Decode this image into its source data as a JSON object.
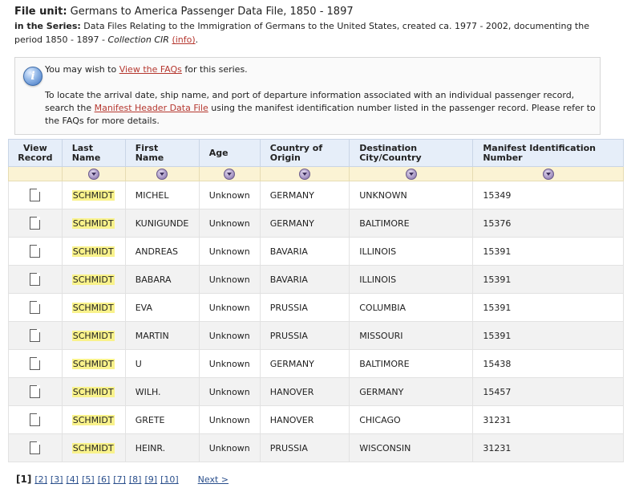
{
  "file_unit": {
    "label": "File unit:",
    "title": "Germans to America Passenger Data File, 1850 - 1897",
    "series_label": "in the Series:",
    "series_text": "Data Files Relating to the Immigration of Germans to the United States, created ca. 1977 - 2002, documenting the period 1850 - 1897 -",
    "collection": "Collection CIR",
    "info_link": "(info)",
    "period": "."
  },
  "info": {
    "icon": "info-icon",
    "line1_pre": "You may wish to ",
    "line1_link": "View the FAQs",
    "line1_post": " for this series.",
    "line2_pre": "To locate the arrival date, ship name, and port of departure information associated with an individual passenger record, search the ",
    "line2_link": "Manifest Header Data File",
    "line2_post": " using the manifest identification number listed in the passenger record. Please refer to the FAQs for more details."
  },
  "table": {
    "headers": {
      "view": "View Record",
      "last": "Last Name",
      "first": "First Name",
      "age": "Age",
      "country": "Country of Origin",
      "dest": "Destination City/Country",
      "manifest": "Manifest Identification Number"
    },
    "rows": [
      {
        "last": "SCHMIDT",
        "first": "MICHEL",
        "age": "Unknown",
        "country": "GERMANY",
        "dest": "UNKNOWN",
        "manifest": "15349"
      },
      {
        "last": "SCHMIDT",
        "first": "KUNIGUNDE",
        "age": "Unknown",
        "country": "GERMANY",
        "dest": "BALTIMORE",
        "manifest": "15376"
      },
      {
        "last": "SCHMIDT",
        "first": "ANDREAS",
        "age": "Unknown",
        "country": "BAVARIA",
        "dest": "ILLINOIS",
        "manifest": "15391"
      },
      {
        "last": "SCHMIDT",
        "first": "BABARA",
        "age": "Unknown",
        "country": "BAVARIA",
        "dest": "ILLINOIS",
        "manifest": "15391"
      },
      {
        "last": "SCHMIDT",
        "first": "EVA",
        "age": "Unknown",
        "country": "PRUSSIA",
        "dest": "COLUMBIA",
        "manifest": "15391"
      },
      {
        "last": "SCHMIDT",
        "first": "MARTIN",
        "age": "Unknown",
        "country": "PRUSSIA",
        "dest": "MISSOURI",
        "manifest": "15391"
      },
      {
        "last": "SCHMIDT",
        "first": "U",
        "age": "Unknown",
        "country": "GERMANY",
        "dest": "BALTIMORE",
        "manifest": "15438"
      },
      {
        "last": "SCHMIDT",
        "first": "WILH.",
        "age": "Unknown",
        "country": "HANOVER",
        "dest": "GERMANY",
        "manifest": "15457"
      },
      {
        "last": "SCHMIDT",
        "first": "GRETE",
        "age": "Unknown",
        "country": "HANOVER",
        "dest": "CHICAGO",
        "manifest": "31231"
      },
      {
        "last": "SCHMIDT",
        "first": "HEINR.",
        "age": "Unknown",
        "country": "PRUSSIA",
        "dest": "WISCONSIN",
        "manifest": "31231"
      }
    ]
  },
  "pager": {
    "current": "[1]",
    "pages": [
      "[2]",
      "[3]",
      "[4]",
      "[5]",
      "[6]",
      "[7]",
      "[8]",
      "[9]",
      "[10]"
    ],
    "next": "Next >"
  }
}
